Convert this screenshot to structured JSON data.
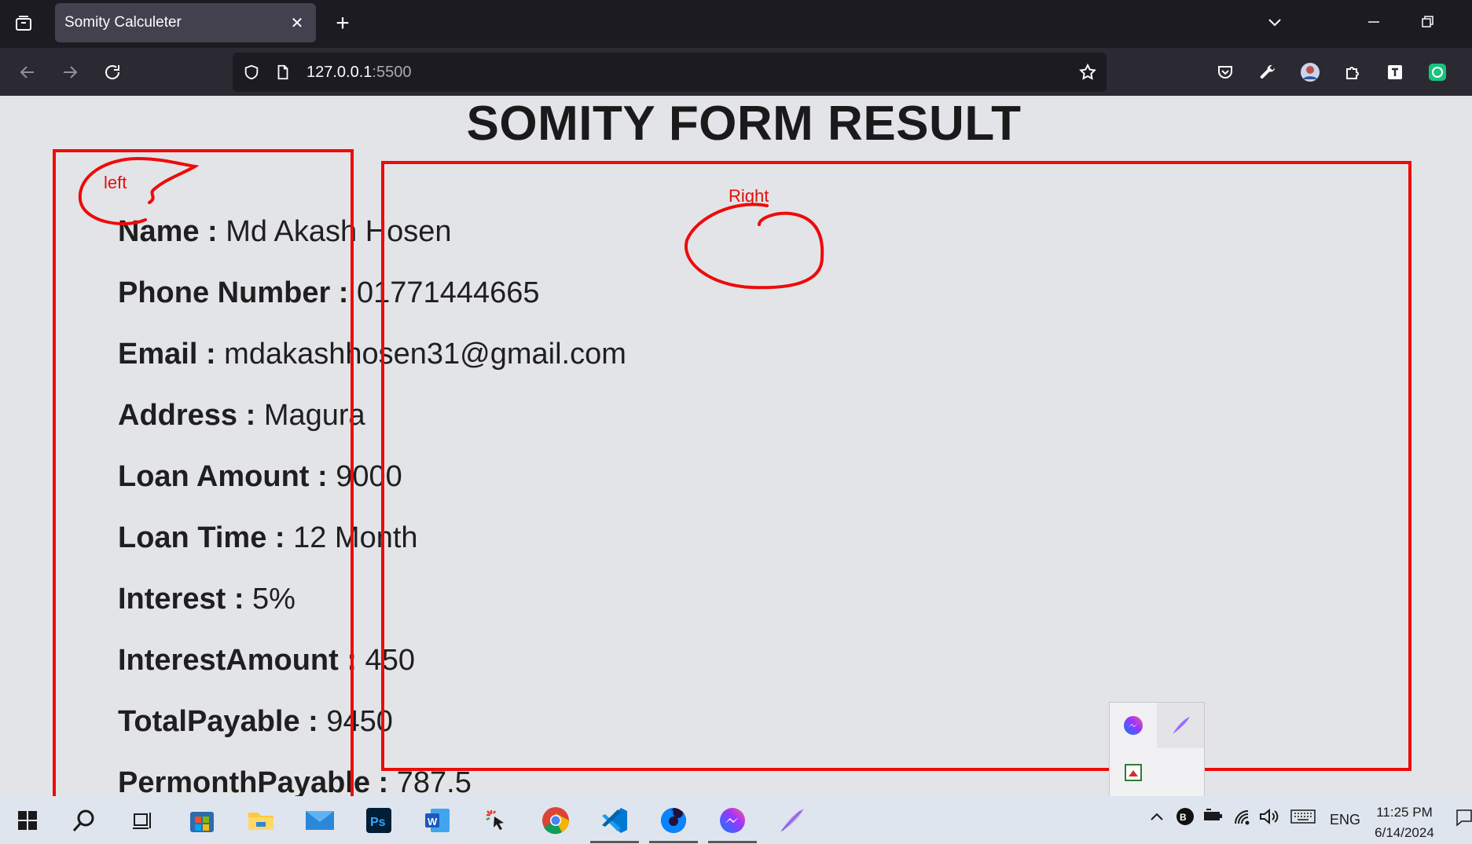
{
  "browser": {
    "tab_title": "Somity Calculeter",
    "url_host": "127.0.0.1",
    "url_port": ":5500"
  },
  "page": {
    "title": "SOMITY FORM RESULT",
    "fields": [
      {
        "label": "Name :",
        "value": " Md Akash Hosen"
      },
      {
        "label": "Phone Number :",
        "value": " 01771444665"
      },
      {
        "label": "Email :",
        "value": " mdakashhosen31@gmail.com"
      },
      {
        "label": "Address :",
        "value": " Magura"
      },
      {
        "label": "Loan Amount :",
        "value": " 9000"
      },
      {
        "label": "Loan Time :",
        "value": " 12 Month"
      },
      {
        "label": "Interest :",
        "value": " 5%"
      },
      {
        "label": "InterestAmount :",
        "value": " 450"
      },
      {
        "label": "TotalPayable :",
        "value": " 9450"
      },
      {
        "label": "PermonthPayable :",
        "value": " 787.5"
      }
    ],
    "annotations": {
      "left": "left",
      "right": "Right"
    },
    "annotation_color": "#ee0b0b"
  },
  "taskbar": {
    "language": "ENG",
    "time": "11:25 PM",
    "date": "6/14/2024"
  }
}
